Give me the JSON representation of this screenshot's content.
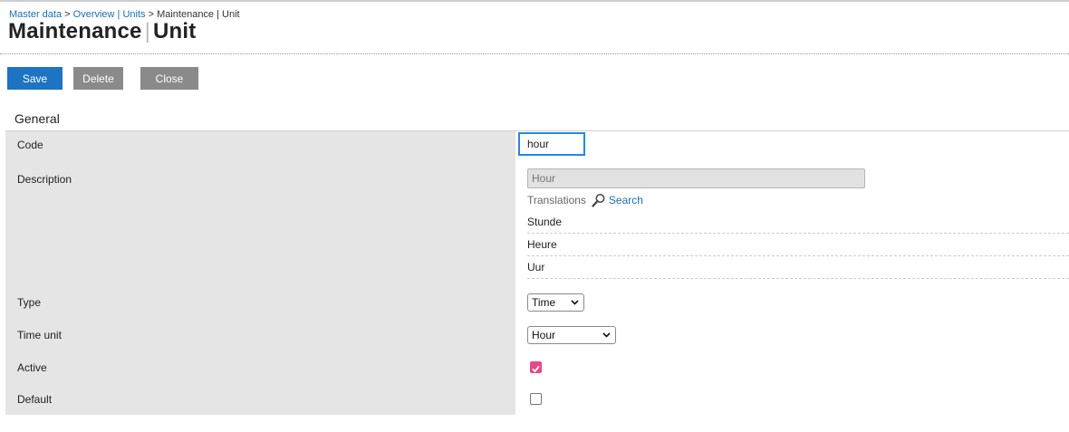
{
  "breadcrumb": {
    "items": [
      "Master data",
      "Overview | Units",
      "Maintenance | Unit"
    ],
    "separator": ">"
  },
  "title": {
    "part1": "Maintenance",
    "divider": "|",
    "part2": "Unit"
  },
  "toolbar": {
    "save_label": "Save",
    "delete_label": "Delete",
    "close_label": "Close"
  },
  "section": {
    "title": "General"
  },
  "fields": {
    "code": {
      "label": "Code",
      "value": "hour"
    },
    "description": {
      "label": "Description",
      "placeholder": "Hour",
      "translations_label": "Translations",
      "search_label": "Search",
      "translations": [
        "Stunde",
        "Heure",
        "Uur"
      ]
    },
    "type": {
      "label": "Type",
      "selected": "Time"
    },
    "time_unit": {
      "label": "Time unit",
      "selected": "Hour"
    },
    "active": {
      "label": "Active",
      "checked": true
    },
    "default": {
      "label": "Default",
      "checked": false
    }
  },
  "colors": {
    "primary": "#1d74c2",
    "secondary_button": "#8a8a8a",
    "focus_border": "#2389e6",
    "checkbox_checked": "#e8488a",
    "link": "#1a6fb5",
    "label_bg": "#e5e5e5"
  }
}
